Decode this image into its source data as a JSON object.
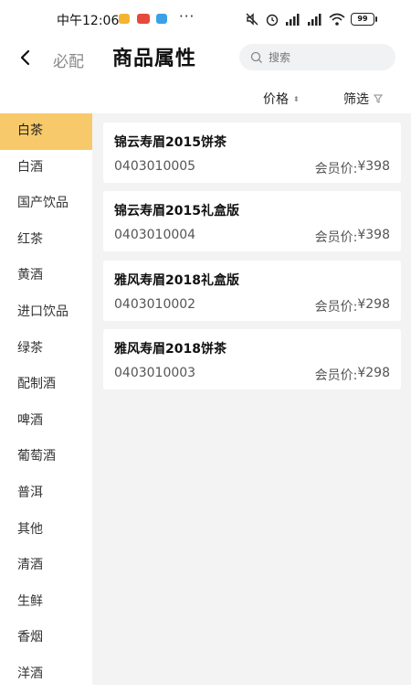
{
  "status_bar": {
    "time": "中午12:06",
    "more": "···",
    "battery": "99"
  },
  "header": {
    "back_icon": "chevron-left-icon",
    "subtitle": "必配",
    "title": "商品属性",
    "search_placeholder": "搜索"
  },
  "sort_bar": {
    "price_label": "价格",
    "filter_label": "筛选"
  },
  "sidebar": {
    "items": [
      {
        "label": "白茶",
        "active": true
      },
      {
        "label": "白酒"
      },
      {
        "label": "国产饮品"
      },
      {
        "label": "红茶"
      },
      {
        "label": "黄酒"
      },
      {
        "label": "进口饮品"
      },
      {
        "label": "绿茶"
      },
      {
        "label": "配制酒"
      },
      {
        "label": "啤酒"
      },
      {
        "label": "葡萄酒"
      },
      {
        "label": "普洱"
      },
      {
        "label": "其他"
      },
      {
        "label": "清酒"
      },
      {
        "label": "生鲜"
      },
      {
        "label": "香烟"
      },
      {
        "label": "洋酒"
      }
    ]
  },
  "products": [
    {
      "name": "锦云寿眉2015饼茶",
      "code": "0403010005",
      "price_label": "会员价:",
      "price": "¥398"
    },
    {
      "name": "锦云寿眉2015礼盒版",
      "code": "0403010004",
      "price_label": "会员价:",
      "price": "¥398"
    },
    {
      "name": "雅风寿眉2018礼盒版",
      "code": "0403010002",
      "price_label": "会员价:",
      "price": "¥298"
    },
    {
      "name": "雅风寿眉2018饼茶",
      "code": "0403010003",
      "price_label": "会员价:",
      "price": "¥298"
    }
  ],
  "colors": {
    "active_category": "#f8c96a",
    "list_background": "#f3f3f3"
  }
}
